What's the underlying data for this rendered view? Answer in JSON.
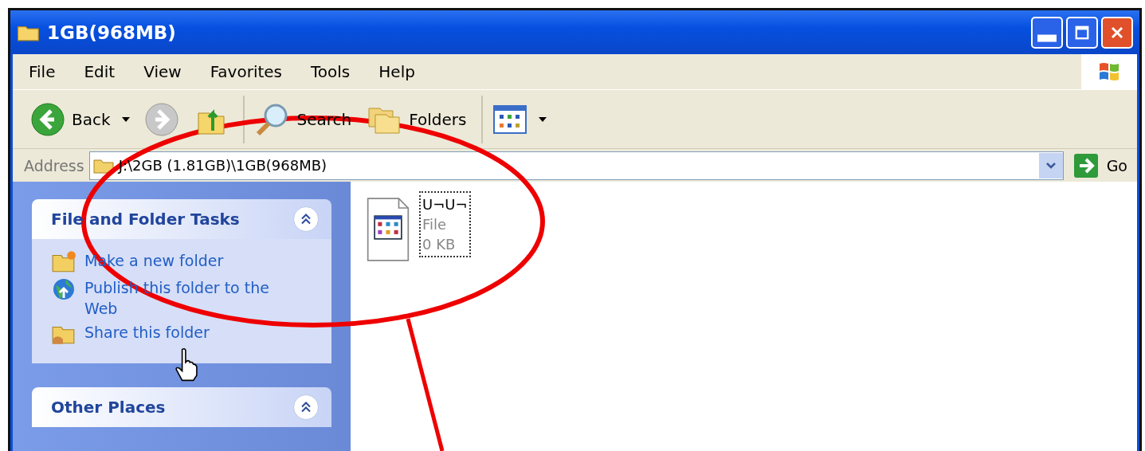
{
  "window": {
    "title": "1GB(968MB)"
  },
  "menu": [
    "File",
    "Edit",
    "View",
    "Favorites",
    "Tools",
    "Help"
  ],
  "toolbar": {
    "back": "Back",
    "forward": {
      "disabled": true
    },
    "search": "Search",
    "folders": "Folders"
  },
  "address": {
    "label": "Address",
    "value": "J:\\2GB (1.81GB)\\1GB(968MB)",
    "go": "Go"
  },
  "task_panels": [
    {
      "title": "File and Folder Tasks",
      "expanded": true,
      "items": [
        {
          "kind": "new-folder",
          "label": "Make a new folder"
        },
        {
          "kind": "publish",
          "label": "Publish this folder to the Web"
        },
        {
          "kind": "share",
          "label": "Share this folder"
        }
      ]
    },
    {
      "title": "Other Places",
      "expanded": true
    }
  ],
  "files": [
    {
      "name": "U¬U¬",
      "type": "File",
      "size": "0 KB",
      "focused": true
    }
  ]
}
